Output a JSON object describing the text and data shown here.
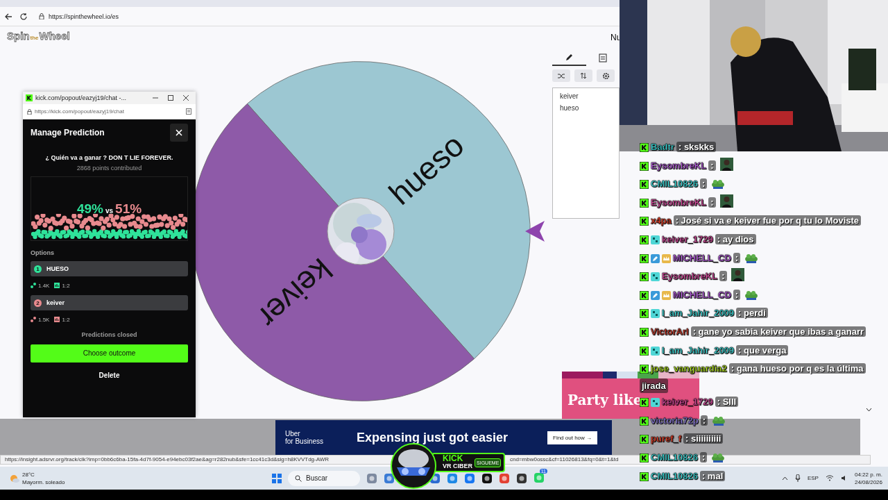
{
  "browser": {
    "url": "https://spinthewheel.io/es"
  },
  "status_url": [
    "https://insight.adsrvr.org/track/clk?imp=0bb6c6ba-15fa-4d7f-9054-e94ebc03f2ae&ag=r282nub&sfe=1cc41c3d&sig=h8KVVTdg-AWR",
    "cnd=mbw0ossc&cf=11026813&fq=0&t=1&td"
  ],
  "page": {
    "logo": [
      "Spin",
      "the",
      "Wheel"
    ],
    "cut_label": "Nu",
    "wheel": {
      "segments": [
        {
          "label": "hueso",
          "color": "#9cc7d2"
        },
        {
          "label": "keiver",
          "color": "#8e5aa8"
        }
      ]
    },
    "entries": [
      "keiver",
      "hueso"
    ]
  },
  "popup": {
    "title": "kick.com/popout/eazyj19/chat -...",
    "url": "https://kick.com/popout/eazyj19/chat",
    "heading": "Manage Prediction",
    "question": "¿ Quién va a ganar ? DON T LIE FOREVER.",
    "points": "2868 points contributed",
    "vs": "vs",
    "options_label": "Options",
    "options": [
      {
        "number": "1",
        "name": "HUESO",
        "percent": "49%",
        "color": "#2fe39a",
        "users": "1.4K",
        "ratio": "1:2"
      },
      {
        "number": "2",
        "name": "keiver",
        "percent": "51%",
        "color": "#e88a8e",
        "users": "1.5K",
        "ratio": "1:2"
      }
    ],
    "status": "Predictions closed",
    "primary_button": "Choose outcome",
    "delete_button": "Delete"
  },
  "chat": {
    "messages": [
      {
        "user": "Badtr",
        "color": "#3fd6d6",
        "badges": [
          {
            "kind": "kick"
          }
        ],
        "text": ": skskks"
      },
      {
        "user": "EysombreKL",
        "color": "#b05cd6",
        "badges": [
          {
            "kind": "kick"
          }
        ],
        "text": ":",
        "emote": {
          "kind": "avatar"
        }
      },
      {
        "user": "CMIL10826",
        "color": "#3fd6d6",
        "badges": [
          {
            "kind": "kick"
          }
        ],
        "text": ":",
        "emote": {
          "kind": "frog"
        }
      },
      {
        "user": "EysombreKL",
        "color": "#d04a9a",
        "badges": [
          {
            "kind": "kick"
          }
        ],
        "text": ":",
        "emote": {
          "kind": "avatar"
        }
      },
      {
        "user": "x4pa",
        "color": "#e0402a",
        "badges": [
          {
            "kind": "kick"
          }
        ],
        "text": ": José si va e keiver fue por q tu lo Moviste"
      },
      {
        "user": "keiver_1729",
        "color": "#d04a9a",
        "badges": [
          {
            "kind": "kick"
          },
          {
            "kind": "sub"
          }
        ],
        "text": ": ay dios"
      },
      {
        "user": "MICHELL_CD",
        "color": "#b05cd6",
        "badges": [
          {
            "kind": "kick"
          },
          {
            "kind": "pencil"
          },
          {
            "kind": "crown"
          }
        ],
        "text": ":",
        "emote": {
          "kind": "frog"
        }
      },
      {
        "user": "EysombreKL",
        "color": "#d04a9a",
        "badges": [
          {
            "kind": "kick"
          },
          {
            "kind": "sub"
          }
        ],
        "text": ":",
        "emote": {
          "kind": "avatar"
        }
      },
      {
        "user": "MICHELL_CD",
        "color": "#b05cd6",
        "badges": [
          {
            "kind": "kick"
          },
          {
            "kind": "pencil"
          },
          {
            "kind": "crown"
          }
        ],
        "text": ":",
        "emote": {
          "kind": "frog"
        }
      },
      {
        "user": "I_am_Jahir_2009",
        "color": "#3fd6d6",
        "badges": [
          {
            "kind": "kick"
          },
          {
            "kind": "sub"
          }
        ],
        "text": ": perdi"
      },
      {
        "user": "VictorArl",
        "color": "#c0392b",
        "badges": [
          {
            "kind": "kick"
          }
        ],
        "text": ": gane yo sabia keiver que ibas a ganarr"
      },
      {
        "user": "I_am_Jahir_2009",
        "color": "#3fd6d6",
        "badges": [
          {
            "kind": "kick"
          },
          {
            "kind": "sub"
          }
        ],
        "text": ": que verga"
      },
      {
        "user": "jose_vanguardia2",
        "color": "#b0e020",
        "badges": [
          {
            "kind": "kick"
          }
        ],
        "text": ": gana hueso por q es la última",
        "wrapped": "jirada"
      },
      {
        "user": "keiver_1729",
        "color": "#d04a9a",
        "badges": [
          {
            "kind": "kick"
          },
          {
            "kind": "sub"
          }
        ],
        "text": ": SIII"
      },
      {
        "user": "victoria72p",
        "color": "#8a7ad6",
        "badges": [
          {
            "kind": "kick"
          }
        ],
        "text": ":",
        "emote": {
          "kind": "frog"
        }
      },
      {
        "user": "puref_f",
        "color": "#e0402a",
        "badges": [
          {
            "kind": "kick"
          }
        ],
        "text": ": siiiiiiiiii"
      },
      {
        "user": "CMIL10826",
        "color": "#3fd6d6",
        "badges": [
          {
            "kind": "kick"
          }
        ],
        "text": ":",
        "emote": {
          "kind": "frog"
        }
      },
      {
        "user": "CMIL10826",
        "color": "#3fd6d6",
        "badges": [
          {
            "kind": "kick"
          }
        ],
        "text": ": mal"
      }
    ]
  },
  "ads": {
    "party": "Party like",
    "uber": {
      "brand": "Uber",
      "sub": "for Business",
      "headline": "Expensing just got easier",
      "cta": "Find out how →"
    }
  },
  "overlay_logo": {
    "title": "KICK",
    "subtitle": "VR CIBER",
    "follow": "SIGUEME"
  },
  "taskbar": {
    "temperature": "28°C",
    "weather": "Mayorm. soleado",
    "search": "Buscar",
    "whatsapp_badge": "11",
    "language": "ESP",
    "time": "04:22 p. m.",
    "date": "24/08/2026"
  }
}
